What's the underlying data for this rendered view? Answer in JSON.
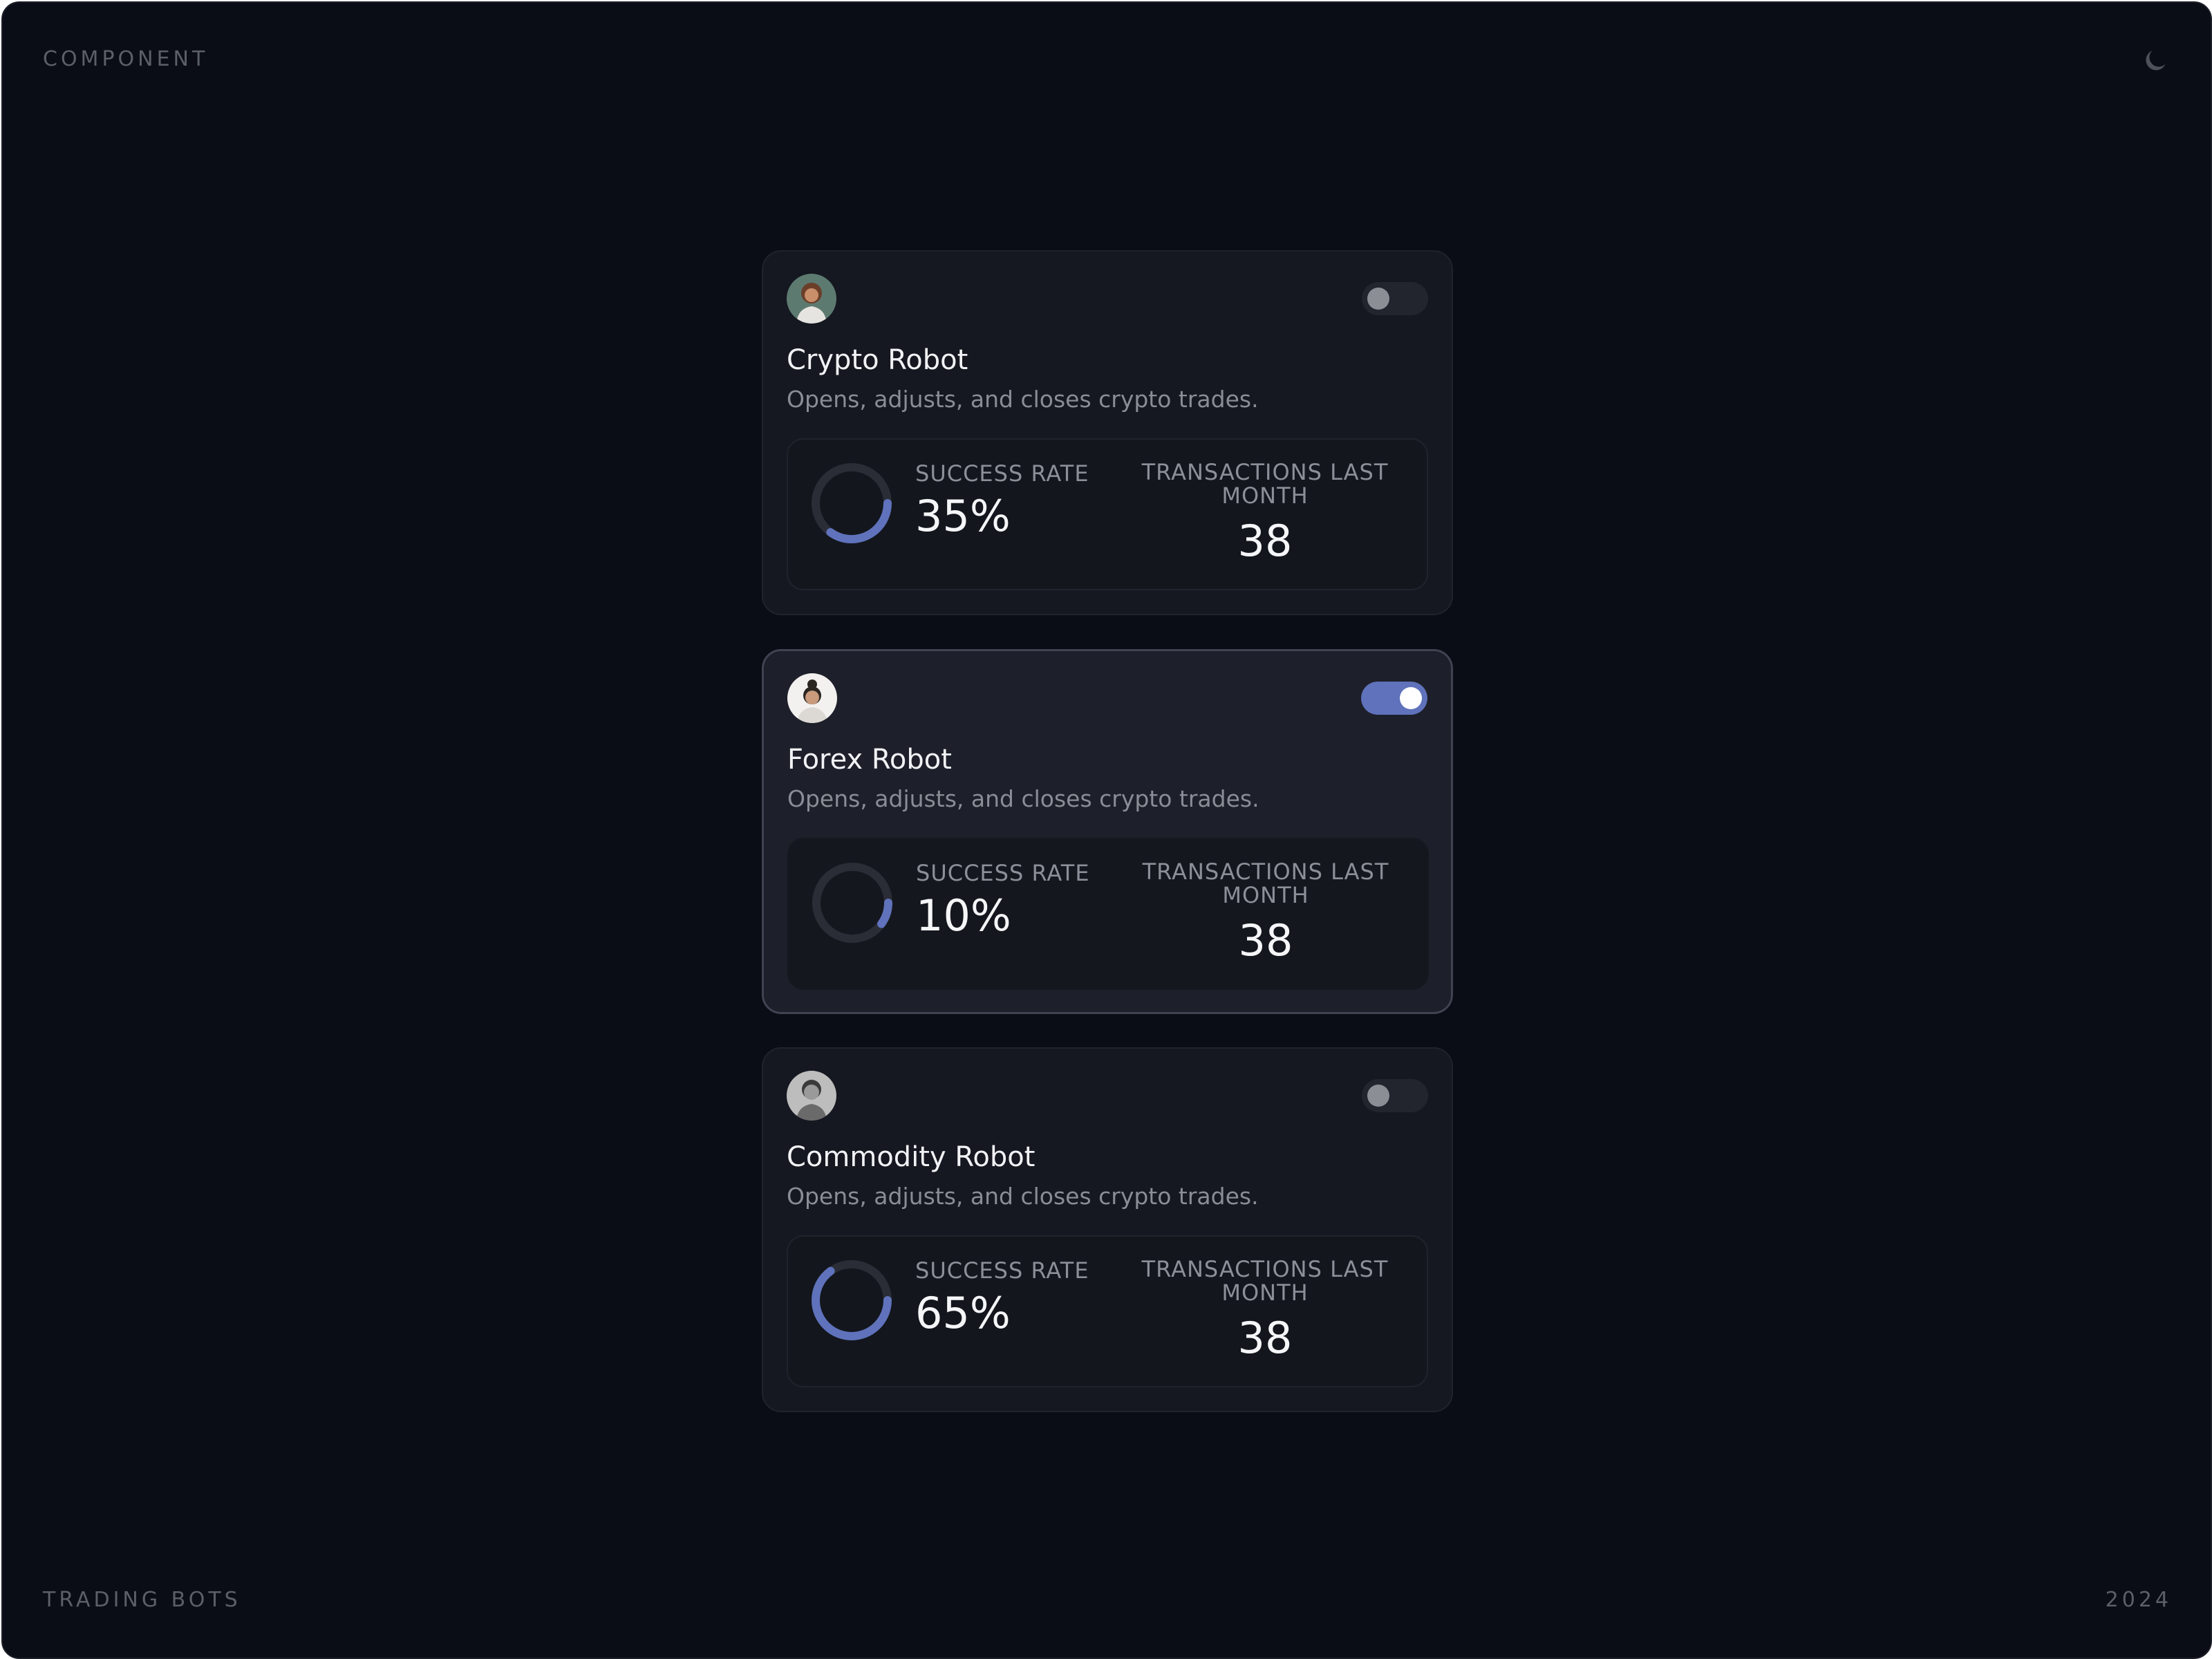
{
  "header": {
    "label": "COMPONENT",
    "theme_icon": "moon-icon"
  },
  "footer": {
    "left": "TRADING BOTS",
    "right": "2024"
  },
  "colors": {
    "accent": "#5f72bb",
    "track": "#2a2d36",
    "background": "#0a0d15"
  },
  "bots": [
    {
      "name": "Crypto Robot",
      "description": "Opens, adjusts, and closes crypto trades.",
      "enabled": false,
      "success_rate_label": "SUCCESS RATE",
      "success_rate": "35%",
      "success_rate_value": 0.35,
      "transactions_label": "TRANSACTIONS LAST MONTH",
      "transactions": "38"
    },
    {
      "name": "Forex Robot",
      "description": "Opens, adjusts, and closes crypto trades.",
      "enabled": true,
      "success_rate_label": "SUCCESS RATE",
      "success_rate": "10%",
      "success_rate_value": 0.1,
      "transactions_label": "TRANSACTIONS LAST MONTH",
      "transactions": "38"
    },
    {
      "name": "Commodity Robot",
      "description": "Opens, adjusts, and closes crypto trades.",
      "enabled": false,
      "success_rate_label": "SUCCESS RATE",
      "success_rate": "65%",
      "success_rate_value": 0.65,
      "transactions_label": "TRANSACTIONS LAST MONTH",
      "transactions": "38"
    }
  ]
}
